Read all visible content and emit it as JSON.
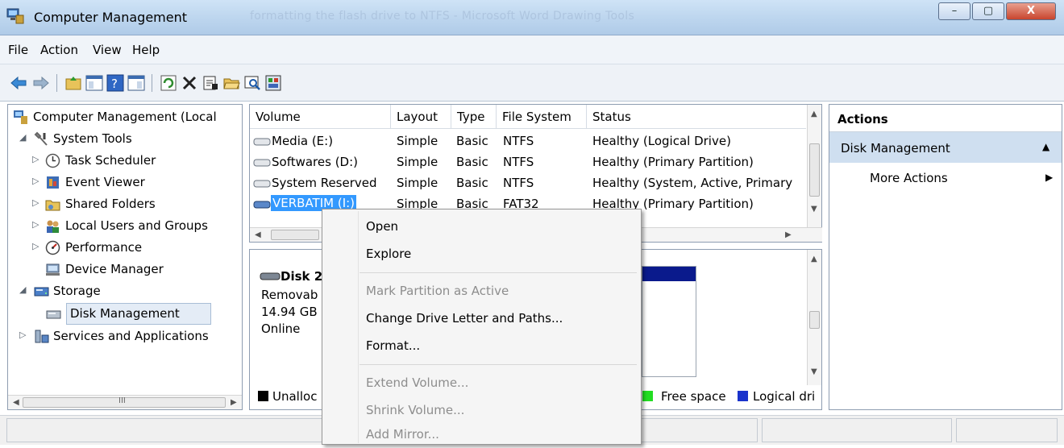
{
  "window": {
    "title": "Computer Management",
    "ghost_title": "formatting the flash drive to NTFS - Microsoft Word                     Drawing Tools",
    "minimize": "–",
    "maximize": "▢",
    "close": "X"
  },
  "menu": [
    "File",
    "Action",
    "View",
    "Help"
  ],
  "tree": {
    "root": "Computer Management (Local",
    "system_tools": "System Tools",
    "task_scheduler": "Task Scheduler",
    "event_viewer": "Event Viewer",
    "shared_folders": "Shared Folders",
    "local_users": "Local Users and Groups",
    "performance": "Performance",
    "device_manager": "Device Manager",
    "storage": "Storage",
    "disk_management": "Disk Management",
    "services": "Services and Applications",
    "scroll_grip": "III"
  },
  "volume_list": {
    "columns": [
      "Volume",
      "Layout",
      "Type",
      "File System",
      "Status"
    ],
    "rows": [
      {
        "volume": "Media (E:)",
        "layout": "Simple",
        "type": "Basic",
        "fs": "NTFS",
        "status": "Healthy (Logical Drive)"
      },
      {
        "volume": "Softwares (D:)",
        "layout": "Simple",
        "type": "Basic",
        "fs": "NTFS",
        "status": "Healthy (Primary Partition)"
      },
      {
        "volume": "System Reserved",
        "layout": "Simple",
        "type": "Basic",
        "fs": "NTFS",
        "status": "Healthy (System, Active, Primary"
      },
      {
        "volume": "VERBATIM (I:)",
        "layout": "Simple",
        "type": "Basic",
        "fs": "FAT32",
        "status": "Healthy (Primary Partition)"
      }
    ]
  },
  "disk_view": {
    "disk_name": "Disk 2",
    "disk_type": "Removab",
    "disk_size": "14.94 GB",
    "disk_state": "Online",
    "legend_unalloc": "Unalloc",
    "legend_free": "Free space",
    "legend_logical": "Logical dri",
    "legend_colors": {
      "unallocated": "#000000",
      "free": "#22dd22",
      "logical": "#1a33cc"
    }
  },
  "actions": {
    "header": "Actions",
    "section": "Disk Management",
    "more": "More Actions"
  },
  "context_menu": {
    "open": "Open",
    "explore": "Explore",
    "mark_active": "Mark Partition as Active",
    "change_letter": "Change Drive Letter and Paths...",
    "format": "Format...",
    "extend": "Extend Volume...",
    "shrink": "Shrink Volume...",
    "add_mirror": "Add Mirror..."
  },
  "colors": {
    "selection": "#3399ff",
    "actions_section_bg": "#cfdff0",
    "partition_header": "#0a1a8c"
  }
}
